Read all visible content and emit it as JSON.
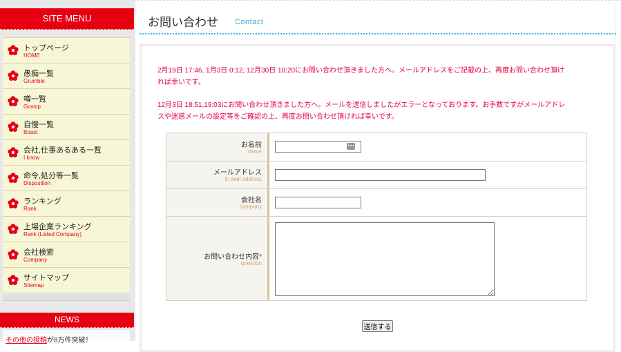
{
  "sidebar": {
    "menu_title": "SITE MENU",
    "items": [
      {
        "ja": "トップページ",
        "en": "HOME"
      },
      {
        "ja": "愚痴一覧",
        "en": "Grumble"
      },
      {
        "ja": "噂一覧",
        "en": "Gossip"
      },
      {
        "ja": "自慢一覧",
        "en": "Boast"
      },
      {
        "ja": "会社,仕事あるある一覧",
        "en": "I know"
      },
      {
        "ja": "命令,処分等一覧",
        "en": "Disposition"
      },
      {
        "ja": "ランキング",
        "en": "Rank"
      },
      {
        "ja": "上場企業ランキング",
        "en": "Rank (Listed Company)"
      },
      {
        "ja": "会社検索",
        "en": "Company"
      },
      {
        "ja": "サイトマップ",
        "en": "Sitemap"
      }
    ],
    "news_title": "NEWS",
    "news_link": "その他の投稿",
    "news_text": "が8万件突破！"
  },
  "main": {
    "title": "お問い合わせ",
    "title_en": "Contact",
    "notices": [
      "2月19日 17:46, 1月3日 0:12, 12月30日 10:20にお問い合わせ頂きました方へ。メールアドレスをご記載の上、再度お問い合わせ頂け",
      "れば幸いです。",
      "12月3日 18:51,19:03にお問い合わせ頂きました方へ。メールを送信しましたがエラーとなっております。お手数ですがメールアドレ",
      "スや迷惑メールの設定等をご確認の上、再度お問い合わせ頂ければ幸いです。"
    ],
    "form": {
      "name_label": "お名前",
      "name_label_en": "name",
      "email_label": "メールアドレス",
      "email_label_en": "E-mail address",
      "company_label": "会社名",
      "company_label_en": "company",
      "question_label": "お問い合わせ内容",
      "required_mark": "*",
      "question_label_en": "question",
      "submit_label": "送信する"
    }
  },
  "colors": {
    "accent_red": "#e60012",
    "notice_pink": "#e6003c",
    "title_blue": "#3ab0d0",
    "menu_bg": "#f7f7d7"
  },
  "icons": {
    "menu_bullet": "red-flower-icon",
    "autofill": "autofill-key-icon"
  }
}
